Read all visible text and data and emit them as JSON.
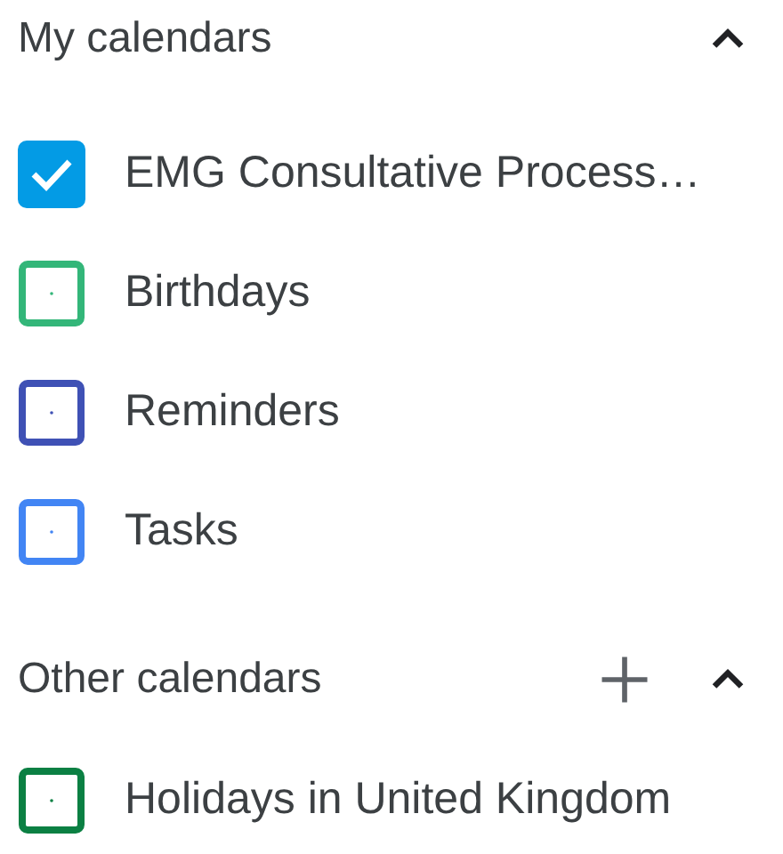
{
  "sections": [
    {
      "title": "My calendars",
      "expanded": true,
      "add_button": false,
      "calendars": [
        {
          "name": "EMG Consultative Process…",
          "checked": true,
          "color": "#039be5"
        },
        {
          "name": "Birthdays",
          "checked": false,
          "color": "#33b679"
        },
        {
          "name": "Reminders",
          "checked": false,
          "color": "#3f51b5"
        },
        {
          "name": "Tasks",
          "checked": false,
          "color": "#4285f4"
        }
      ]
    },
    {
      "title": "Other calendars",
      "expanded": true,
      "add_button": true,
      "calendars": [
        {
          "name": "Holidays in United Kingdom",
          "checked": false,
          "color": "#0b8043"
        }
      ]
    }
  ]
}
